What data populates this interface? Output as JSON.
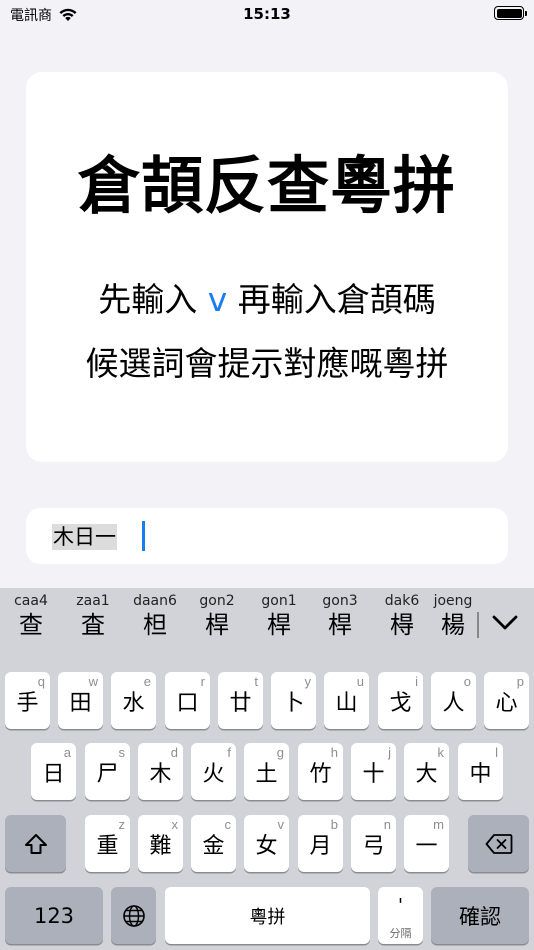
{
  "status_bar": {
    "carrier": "電訊商",
    "time": "15:13"
  },
  "card": {
    "title": "倉頡反查粵拼",
    "line1_pre": "先輸入",
    "line1_key": "v",
    "line1_post": "再輸入倉頡碼",
    "line2": "候選詞會提示對應嘅粵拼"
  },
  "input": {
    "value": "木日一"
  },
  "keyboard": {
    "candidates": [
      {
        "roman": "caa4",
        "han": "查"
      },
      {
        "roman": "zaa1",
        "han": "査"
      },
      {
        "roman": "daan6",
        "han": "柦"
      },
      {
        "roman": "gon2",
        "han": "桿"
      },
      {
        "roman": "gon1",
        "han": "桿"
      },
      {
        "roman": "gon3",
        "han": "桿"
      },
      {
        "roman": "dak6",
        "han": "棏"
      },
      {
        "roman": "joeng",
        "han": "楊"
      }
    ],
    "row1": [
      {
        "label": "手",
        "hint": "q"
      },
      {
        "label": "田",
        "hint": "w"
      },
      {
        "label": "水",
        "hint": "e"
      },
      {
        "label": "口",
        "hint": "r"
      },
      {
        "label": "廿",
        "hint": "t"
      },
      {
        "label": "卜",
        "hint": "y"
      },
      {
        "label": "山",
        "hint": "u"
      },
      {
        "label": "戈",
        "hint": "i"
      },
      {
        "label": "人",
        "hint": "o"
      },
      {
        "label": "心",
        "hint": "p"
      }
    ],
    "row2": [
      {
        "label": "日",
        "hint": "a"
      },
      {
        "label": "尸",
        "hint": "s"
      },
      {
        "label": "木",
        "hint": "d"
      },
      {
        "label": "火",
        "hint": "f"
      },
      {
        "label": "土",
        "hint": "g"
      },
      {
        "label": "竹",
        "hint": "h"
      },
      {
        "label": "十",
        "hint": "j"
      },
      {
        "label": "大",
        "hint": "k"
      },
      {
        "label": "中",
        "hint": "l"
      }
    ],
    "row3": [
      {
        "label": "重",
        "hint": "z"
      },
      {
        "label": "難",
        "hint": "x"
      },
      {
        "label": "金",
        "hint": "c"
      },
      {
        "label": "女",
        "hint": "v"
      },
      {
        "label": "月",
        "hint": "b"
      },
      {
        "label": "弓",
        "hint": "n"
      },
      {
        "label": "一",
        "hint": "m"
      }
    ],
    "numbers_label": "123",
    "space_label": "粵拼",
    "separator_symbol": "'",
    "separator_label": "分隔",
    "confirm_label": "確認"
  },
  "icons": {
    "wifi": "wifi-icon",
    "battery": "battery-icon",
    "expand": "chevron-down-icon",
    "shift": "shift-icon",
    "delete": "delete-icon",
    "globe": "globe-icon"
  },
  "colors": {
    "accent": "#1a7cf2",
    "background": "#f2f2f7",
    "keyboard": "#d1d3d9",
    "dark_key": "#abb0ba"
  }
}
